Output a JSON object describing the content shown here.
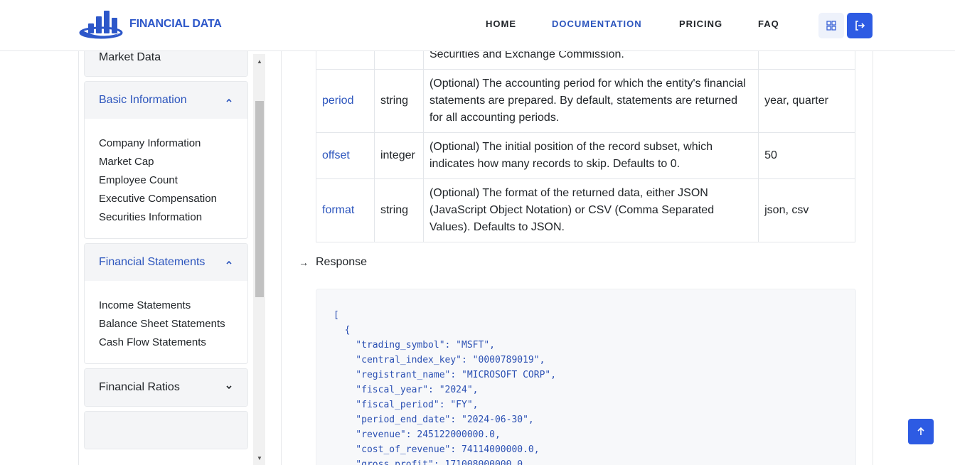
{
  "brand": {
    "name": "FINANCIAL DATA"
  },
  "nav": {
    "items": [
      {
        "label": "HOME"
      },
      {
        "label": "DOCUMENTATION"
      },
      {
        "label": "PRICING"
      },
      {
        "label": "FAQ"
      }
    ],
    "active": "DOCUMENTATION"
  },
  "header_actions": {
    "grid_icon": "grid-icon",
    "logout_icon": "logout-icon"
  },
  "sidebar": {
    "partial_top": {
      "label": "Market Data"
    },
    "groups": [
      {
        "label": "Basic Information",
        "expanded": true,
        "items": [
          "Company Information",
          "Market Cap",
          "Employee Count",
          "Executive Compensation",
          "Securities Information"
        ]
      },
      {
        "label": "Financial Statements",
        "expanded": true,
        "items": [
          "Income Statements",
          "Balance Sheet Statements",
          "Cash Flow Statements"
        ]
      },
      {
        "label": "Financial Ratios",
        "expanded": false,
        "items": []
      }
    ]
  },
  "params_table": {
    "partial_row_desc": "Securities and Exchange Commission.",
    "rows": [
      {
        "name": "period",
        "type": "string",
        "desc": "(Optional) The accounting period for which the entity's financial statements are prepared. By default, statements are returned for all accounting periods.",
        "example": "year, quarter"
      },
      {
        "name": "offset",
        "type": "integer",
        "desc": "(Optional) The initial position of the record subset, which indicates how many records to skip. Defaults to 0.",
        "example": "50"
      },
      {
        "name": "format",
        "type": "string",
        "desc": "(Optional) The format of the returned data, either JSON (JavaScript Object Notation) or CSV (Comma Separated Values). Defaults to JSON.",
        "example": "json, csv"
      }
    ]
  },
  "response": {
    "label": "Response",
    "code": "[\n  {\n    \"trading_symbol\": \"MSFT\",\n    \"central_index_key\": \"0000789019\",\n    \"registrant_name\": \"MICROSOFT CORP\",\n    \"fiscal_year\": \"2024\",\n    \"fiscal_period\": \"FY\",\n    \"period_end_date\": \"2024-06-30\",\n    \"revenue\": 245122000000.0,\n    \"cost_of_revenue\": 74114000000.0,\n    \"gross_profit\": 171008000000.0,"
  },
  "colors": {
    "accent": "#2d5be3",
    "link": "#2c55bd",
    "code": "#2b50b3"
  }
}
